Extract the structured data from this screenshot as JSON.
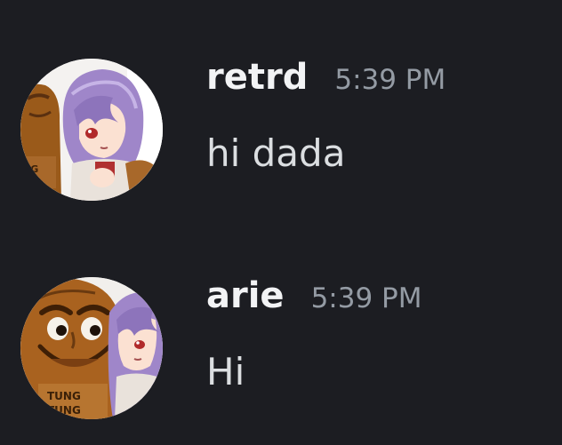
{
  "messages": [
    {
      "username": "retrd",
      "timestamp": "5:39 PM",
      "content": "hi dada",
      "avatar_icon": "anime-girl-with-tung-character-avatar"
    },
    {
      "username": "arie",
      "timestamp": "5:39 PM",
      "content": "Hi",
      "avatar_icon": "tung-character-with-anime-girl-avatar"
    }
  ],
  "colors": {
    "background": "#1c1d22",
    "username": "#f2f3f5",
    "timestamp": "#949ba4",
    "content": "#dbdee1"
  }
}
